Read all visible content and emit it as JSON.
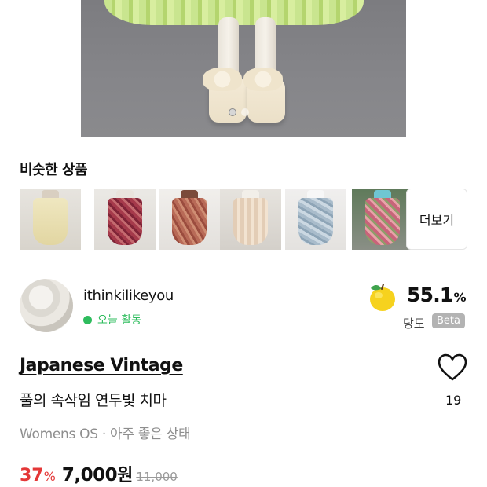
{
  "similar": {
    "title": "비슷한 상품",
    "more_label": "더보기",
    "items": [
      {
        "name": "yellow-maxi-skirt"
      },
      {
        "name": "red-floral-skirt"
      },
      {
        "name": "brown-floral-skirt"
      },
      {
        "name": "lace-beige-skirt"
      },
      {
        "name": "blue-floral-skirt"
      },
      {
        "name": "pink-floral-skirt"
      }
    ]
  },
  "seller": {
    "name": "ithinkilikeyou",
    "status": "오늘 활동",
    "score": "55.1",
    "score_unit": "%",
    "score_label": "당도",
    "beta_label": "Beta"
  },
  "product": {
    "brand": "Japanese Vintage",
    "name": "풀의 속삭임 연두빛 치마",
    "condition": "Womens OS · 아주 좋은 상태",
    "discount": "37",
    "discount_unit": "%",
    "price": "7,000",
    "price_unit": "원",
    "original_price": "11,000",
    "likes": "19"
  },
  "colors": {
    "accent_red": "#e43737",
    "online_green": "#2ebc5d",
    "beta_gray": "#b3b3b3"
  },
  "icons": {
    "heart": "heart-outline-icon",
    "apple": "apple-icon"
  }
}
